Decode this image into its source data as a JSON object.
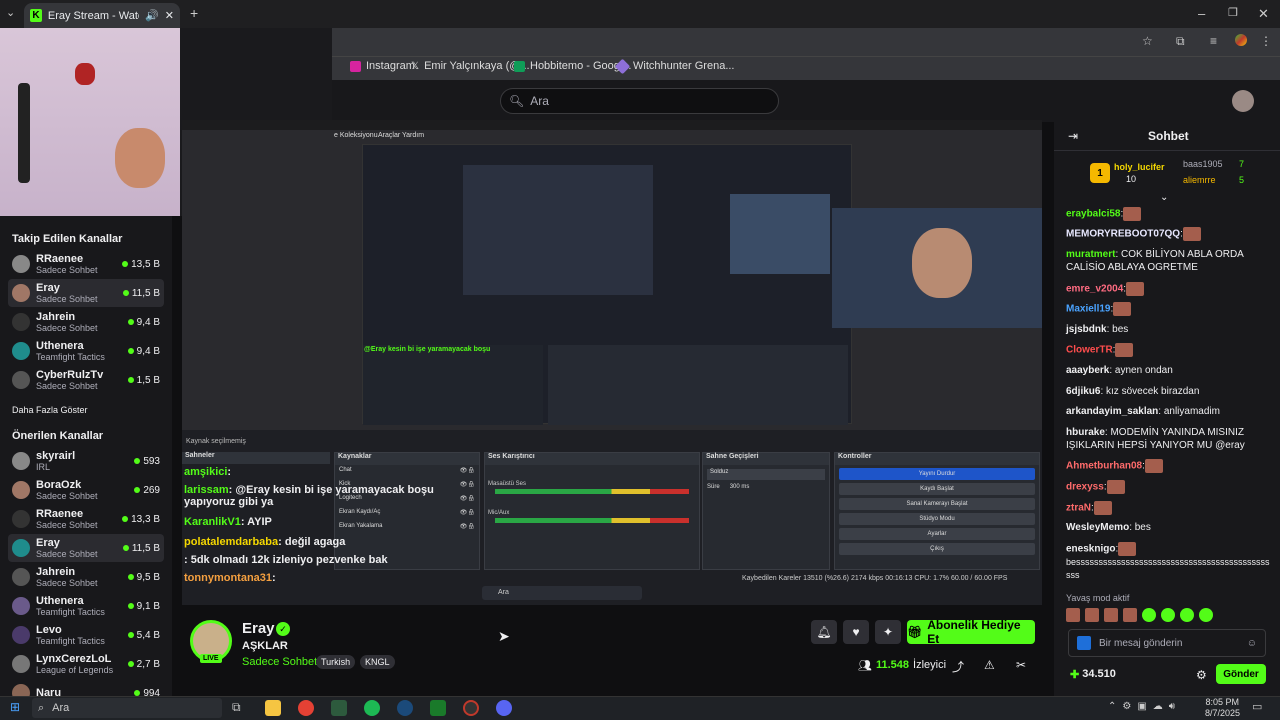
{
  "browser": {
    "tab_title": "Eray Stream - Watch Live o",
    "bookmarks": [
      "Instagram",
      "Emir Yalçınkaya (@...",
      "Hobbitemo - Googl...",
      "Witchhunter Grena..."
    ]
  },
  "header": {
    "search_placeholder": "Ara"
  },
  "sidebar": {
    "followed_title": "Takip Edilen Kanallar",
    "followed": [
      {
        "name": "RRaenee",
        "category": "Sadece Sohbet",
        "viewers": "13,5 B"
      },
      {
        "name": "Eray",
        "category": "Sadece Sohbet",
        "viewers": "11,5 B"
      },
      {
        "name": "Jahrein",
        "category": "Sadece Sohbet",
        "viewers": "9,4 B"
      },
      {
        "name": "Uthenera",
        "category": "Teamfight Tactics",
        "viewers": "9,4 B"
      },
      {
        "name": "CyberRulzTv",
        "category": "Sadece Sohbet",
        "viewers": "1,5 B"
      }
    ],
    "show_more": "Daha Fazla Göster",
    "recommended_title": "Önerilen Kanallar",
    "recommended": [
      {
        "name": "skyrairl",
        "category": "IRL",
        "viewers": "593"
      },
      {
        "name": "BoraOzk",
        "category": "Sadece Sohbet",
        "viewers": "269"
      },
      {
        "name": "RRaenee",
        "category": "Sadece Sohbet",
        "viewers": "13,3 B"
      },
      {
        "name": "Eray",
        "category": "Sadece Sohbet",
        "viewers": "11,5 B"
      },
      {
        "name": "Jahrein",
        "category": "Sadece Sohbet",
        "viewers": "9,5 B"
      },
      {
        "name": "Uthenera",
        "category": "Teamfight Tactics",
        "viewers": "9,1 B"
      },
      {
        "name": "Levo",
        "category": "Teamfight Tactics",
        "viewers": "5,4 B"
      },
      {
        "name": "LynxCerezLoL",
        "category": "League of Legends",
        "viewers": "2,7 B"
      },
      {
        "name": "Naru",
        "category": "",
        "viewers": "994"
      }
    ]
  },
  "video": {
    "obs_menu": [
      "e Koleksiyonu",
      "Araçlar",
      "Yardım"
    ],
    "panels": {
      "scenes": "Sahneler",
      "sources": "Kaynaklar",
      "mixer": "Ses Karıştırıcı",
      "transitions": "Sahne Geçişleri",
      "controls": "Kontroller"
    },
    "sources": [
      "Chat",
      "Kick",
      "Logitech",
      "Ekran Kaydı/Aç",
      "Ekran Yakalama"
    ],
    "mixer_tracks": [
      "Masaüstü Ses",
      "Mic/Aux"
    ],
    "transition": {
      "type": "Solduz",
      "duration_label": "Süre",
      "duration": "300 ms"
    },
    "control_buttons": [
      "Yayını Durdur",
      "Kaydı Başlat",
      "Sanal Kamerayı Başlat",
      "Stüdyo Modu",
      "Ayarlar",
      "Çıkış"
    ],
    "overlay_chat": [
      {
        "user": "amşikici",
        "text": ":"
      },
      {
        "user": "larissam",
        "text": ": @Eray kesin bi işe yaramayacak boşu yapıyoruz gibi ya"
      },
      {
        "user": "KaranlikV1",
        "text": ": AYIP"
      },
      {
        "user": "polatalemdarbaba",
        "text": ": değil agaga"
      },
      {
        "user": "",
        "text": ": 5dk olmadı 12k izleniyo pezvenke bak"
      },
      {
        "user": "tonnymontana31",
        "text": ":"
      }
    ],
    "status": "Kaybedilen Kareler 13510 (%26.6)   2174 kbps   00:16:13   CPU: 1.7%   60.00 / 60.00 FPS",
    "win_search": "Ara"
  },
  "stream": {
    "streamer": "Eray",
    "title": "AŞKLAR",
    "category": "Sadece Sohbet",
    "tags": [
      "Turkish",
      "KNGL"
    ],
    "live": "LIVE",
    "gift_button": "Abonelik Hediye Et",
    "viewers": "11.548",
    "viewers_label": "İzleyici"
  },
  "chat": {
    "title": "Sohbet",
    "leaders": [
      {
        "name": "holy_lucifer",
        "count": "10"
      },
      {
        "name": "baas1905",
        "count": "7"
      },
      {
        "name": "aliemrre",
        "count": "5"
      }
    ],
    "messages": [
      {
        "user": "eraybalci58",
        "text": ":",
        "color": "#53fc18"
      },
      {
        "user": "MEMORYREBOOT07QQ",
        "text": ":",
        "color": "#e8e8ff"
      },
      {
        "user": "muratmert",
        "text": ": COK BİLİYON ABLA ORDA CALİSİO ABLAYA OGRETME",
        "color": "#53fc18"
      },
      {
        "user": "emre_v2004",
        "text": ":",
        "color": "#ff6b81"
      },
      {
        "user": "Maxiell19",
        "text": ":",
        "color": "#4aa3ff"
      },
      {
        "user": "jsjsbdnk",
        "text": ": bes",
        "color": "#efeff1"
      },
      {
        "user": "ClowerTR",
        "text": ":",
        "color": "#ff4d4d"
      },
      {
        "user": "aaayberk",
        "text": ": aynen ondan",
        "color": "#efeff1"
      },
      {
        "user": "6djiku6",
        "text": ": kız sövecek birazdan",
        "color": "#efeff1"
      },
      {
        "user": "arkandayim_saklan",
        "text": ": anliyamadim",
        "color": "#efeff1"
      },
      {
        "user": "hburake",
        "text": ": MODEMİN YANINDA MISINIZ IŞIKLARIN HEPSİ YANIYOR MU @eray",
        "color": "#efeff1"
      },
      {
        "user": "Ahmetburhan08",
        "text": ":",
        "color": "#ff6b6b"
      },
      {
        "user": "drexyss",
        "text": ":",
        "color": "#ff6b6b"
      },
      {
        "user": "ztraN",
        "text": ":",
        "color": "#ff6b6b"
      },
      {
        "user": "WesleyMemo",
        "text": ": bes",
        "color": "#efeff1"
      },
      {
        "user": "enesknigo",
        "text": ":",
        "color": "#efeff1"
      }
    ],
    "long_text": "bessssssssssssssssssssssssssssssssssssssssssssss",
    "slow_mode": "Yavaş mod aktif",
    "input_placeholder": "Bir mesaj gönderin",
    "points": "34.510",
    "send": "Gönder"
  },
  "taskbar": {
    "search": "Ara",
    "time": "8:05 PM",
    "date": "8/7/2025"
  }
}
